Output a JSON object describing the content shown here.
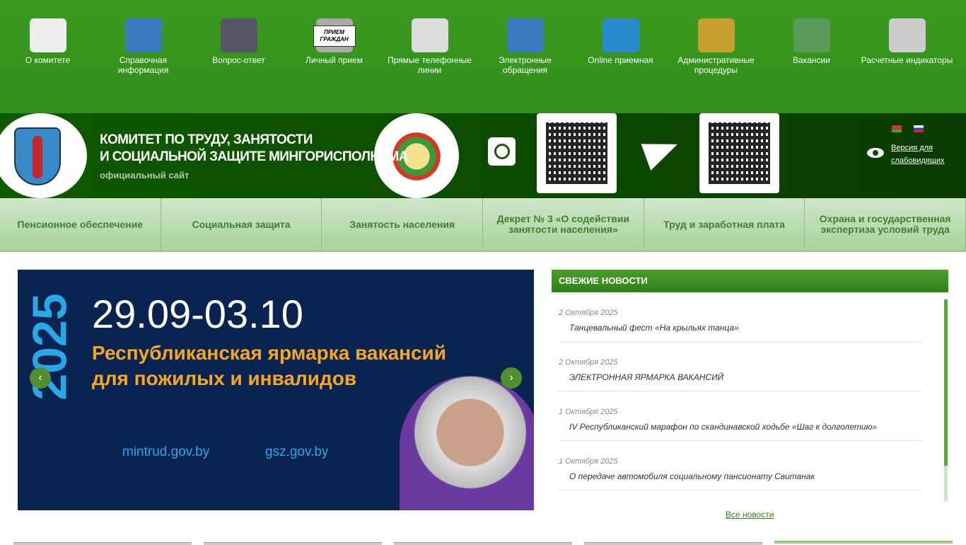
{
  "top_menu": [
    {
      "label": "О комитете",
      "icon": "book-icon"
    },
    {
      "label": "Справочная информация",
      "icon": "info-cube-icon"
    },
    {
      "label": "Вопрос-ответ",
      "icon": "question-chat-icon"
    },
    {
      "label": "Личный прием",
      "icon": "sign-person-icon",
      "sign": "ПРИЕМ ГРАЖДАН"
    },
    {
      "label": "Прямые телефонные линии",
      "icon": "clock-phone-icon"
    },
    {
      "label": "Электронные обращения",
      "icon": "globe-icon"
    },
    {
      "label": "Online приемная",
      "icon": "at-icon"
    },
    {
      "label": "Административные процедуры",
      "icon": "pen-icon"
    },
    {
      "label": "Вакансии",
      "icon": "building-icon"
    },
    {
      "label": "Расчетные индикаторы",
      "icon": "calculator-icon"
    }
  ],
  "header": {
    "title_line1": "КОМИТЕТ ПО ТРУДУ, ЗАНЯТОСТИ",
    "title_line2": "И СОЦИАЛЬНОЙ ЗАЩИТЕ МИНГОРИСПОЛКОМА",
    "subtitle": "официальный сайт",
    "accessibility": "Версия для слабовидящих"
  },
  "nav": [
    "Пенсионное обеспечение",
    "Социальная защита",
    "Занятость населения",
    "Декрет № 3 «О содействии занятости населения»",
    "Труд и заработная плата",
    "Охрана и государственная экспертиза условий труда"
  ],
  "slide": {
    "year": "2025",
    "dates": "29.09-03.10",
    "line1": "Республиканская ярмарка вакансий",
    "line2": "для пожилых и инвалидов",
    "site1": "mintrud.gov.by",
    "site2": "gsz.gov.by"
  },
  "news": {
    "header": "СВЕЖИЕ НОВОСТИ",
    "items": [
      {
        "date": "2 Октября 2025",
        "title": "Танцевальный фест «На крыльях танца»"
      },
      {
        "date": "2 Октября 2025",
        "title": "ЭЛЕКТРОННАЯ ЯРМАРКА ВАКАНСИЙ"
      },
      {
        "date": "1 Октября 2025",
        "title": "IV Республиканский марафон по скандинавской ходьбе «Шаг к долголетию»"
      },
      {
        "date": "1 Октября 2025",
        "title": "О передаче автомобиля социальному пансионату Свитанак"
      }
    ],
    "all": "Все новости"
  },
  "colors": {
    "green": "#3b9a20",
    "dark_green": "#0f5a00",
    "slide_bg": "#0a2452",
    "accent_orange": "#f5a623"
  }
}
